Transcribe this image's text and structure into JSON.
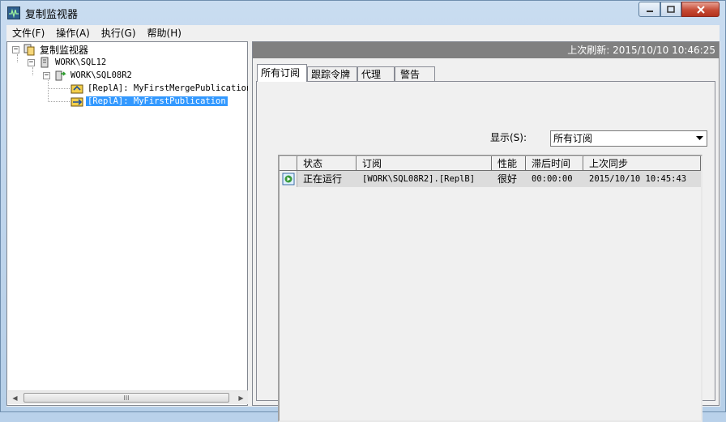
{
  "window": {
    "title": "复制监视器",
    "icon": "replication-monitor-icon"
  },
  "menu": [
    "文件(F)",
    "操作(A)",
    "执行(G)",
    "帮助(H)"
  ],
  "tree": {
    "root": "复制监视器",
    "server": "WORK\\SQL12",
    "publisher": "WORK\\SQL08R2",
    "publications": [
      "[ReplA]: MyFirstMergePublication",
      "[ReplA]: MyFirstPublication"
    ],
    "selected_index": 1
  },
  "status": {
    "last_refresh": "上次刷新: 2015/10/10 10:46:25"
  },
  "tabs": [
    "所有订阅",
    "跟踪令牌",
    "代理",
    "警告"
  ],
  "active_tab": 0,
  "filter": {
    "label": "显示(S):",
    "value": "所有订阅"
  },
  "grid": {
    "columns": [
      "状态",
      "订阅",
      "性能",
      "滞后时间",
      "上次同步"
    ],
    "rows": [
      {
        "status": "正在运行",
        "subscription": "[WORK\\SQL08R2].[ReplB]",
        "performance": "很好",
        "latency": "00:00:00",
        "last_sync": "2015/10/10 10:45:43"
      }
    ]
  },
  "scrollbar": {
    "thumb_glyph": "III"
  }
}
